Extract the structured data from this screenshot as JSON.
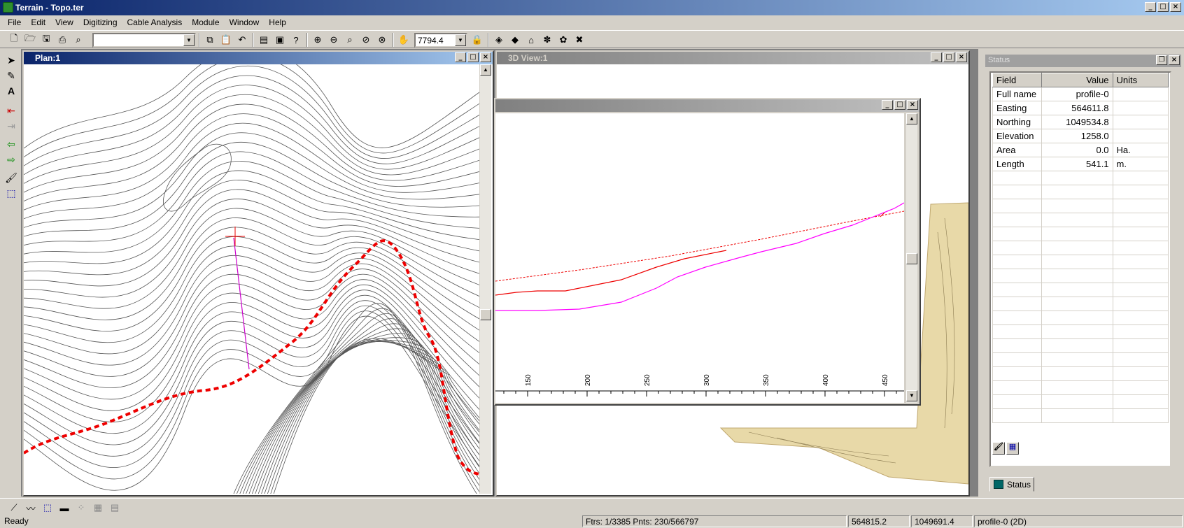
{
  "app": {
    "title": "Terrain - Topo.ter"
  },
  "menu": [
    "File",
    "Edit",
    "View",
    "Digitizing",
    "Cable Analysis",
    "Module",
    "Window",
    "Help"
  ],
  "toolbar": {
    "layer_combo_value": "",
    "scale_value": "7794.4"
  },
  "plan_window": {
    "title": "Plan:1"
  },
  "view3d_window": {
    "title": "3D View:1"
  },
  "profile_window": {
    "title": "",
    "axis_ticks": [
      "150",
      "200",
      "250",
      "300",
      "350",
      "400",
      "450"
    ]
  },
  "status_panel": {
    "title": "Status",
    "columns": {
      "field": "Field",
      "value": "Value",
      "units": "Units"
    },
    "rows": [
      {
        "field": "Full name",
        "value": "profile-0",
        "units": ""
      },
      {
        "field": "Easting",
        "value": "564611.8",
        "units": ""
      },
      {
        "field": "Northing",
        "value": "1049534.8",
        "units": ""
      },
      {
        "field": "Elevation",
        "value": "1258.0",
        "units": ""
      },
      {
        "field": "Area",
        "value": "0.0",
        "units": "Ha."
      },
      {
        "field": "Length",
        "value": "541.1",
        "units": "m."
      }
    ],
    "tab_label": "Status"
  },
  "statusbar": {
    "ready": "Ready",
    "features": "Ftrs: 1/3385  Pnts: 230/566797",
    "easting": "564815.2",
    "northing": "1049691.4",
    "active": "profile-0 (2D)"
  },
  "colors": {
    "profile_line": "#ff0000",
    "ground_line": "#ff00ff",
    "terrain_fill": "#e8d9a8"
  }
}
